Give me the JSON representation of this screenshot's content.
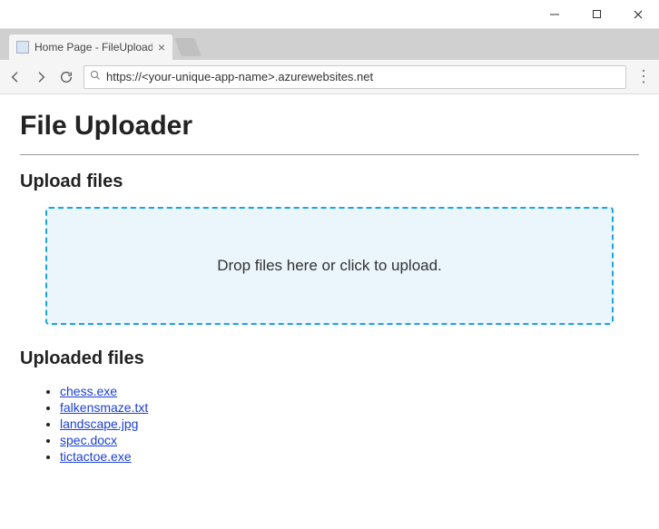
{
  "window": {
    "tab_title": "Home Page - FileUploade",
    "url": "https://<your-unique-app-name>.azurewebsites.net"
  },
  "page": {
    "title": "File Uploader",
    "upload_heading": "Upload files",
    "dropzone_text": "Drop files here or click to upload.",
    "uploaded_heading": "Uploaded files",
    "files": [
      {
        "name": "chess.exe"
      },
      {
        "name": "falkensmaze.txt"
      },
      {
        "name": "landscape.jpg"
      },
      {
        "name": "spec.docx"
      },
      {
        "name": "tictactoe.exe"
      }
    ]
  }
}
